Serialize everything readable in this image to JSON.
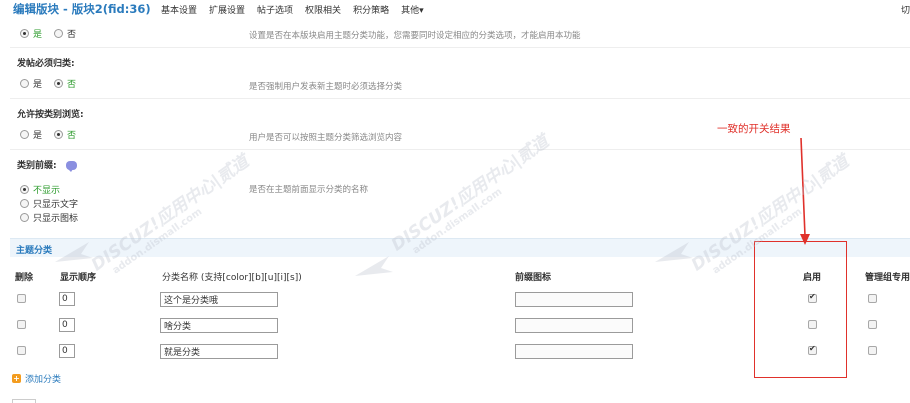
{
  "header": {
    "title": "编辑版块 - 版块2(fid:36)",
    "tabs": [
      "基本设置",
      "扩展设置",
      "帖子选项",
      "权限相关",
      "积分策略",
      "其他▾"
    ],
    "right_label": "切"
  },
  "settings": {
    "enable_topic": {
      "opt_yes": "是",
      "opt_no": "否",
      "selected": "yes",
      "desc": "设置是否在本版块启用主题分类功能，您需要同时设定相应的分类选项，才能启用本功能"
    },
    "require_category": {
      "label": "发帖必须归类:",
      "opt_yes": "是",
      "opt_no": "否",
      "selected": "no",
      "desc": "是否强制用户发表新主题时必须选择分类"
    },
    "browse_by_category": {
      "label": "允许按类别浏览:",
      "opt_yes": "是",
      "opt_no": "否",
      "selected": "no",
      "desc": "用户是否可以按照主题分类筛选浏览内容"
    },
    "category_prefix": {
      "label": "类别前缀:",
      "options": [
        "不显示",
        "只显示文字",
        "只显示图标"
      ],
      "selected": 0,
      "desc": "是否在主题前面显示分类的名称"
    }
  },
  "categories": {
    "section_title": "主题分类",
    "columns": {
      "delete": "删除",
      "order": "显示顺序",
      "name": "分类名称 (支持[color][b][u][i][s])",
      "icon": "前缀图标",
      "enable": "启用",
      "moderator": "管理组专用"
    },
    "rows": [
      {
        "order": "0",
        "name": "这个是分类哦",
        "enabled": true,
        "moderator_only": false
      },
      {
        "order": "0",
        "name": "啥分类",
        "enabled": false,
        "moderator_only": false
      },
      {
        "order": "0",
        "name": "就是分类",
        "enabled": true,
        "moderator_only": false
      }
    ],
    "add_label": "添加分类"
  },
  "annotation": {
    "text": "一致的开关结果",
    "color": "#e0312b"
  },
  "watermark": {
    "brand": "DISCUZ!应用中心|贰道",
    "site": "addon.dismall.com"
  },
  "colors": {
    "accent": "#2b7bbd",
    "selected_option": "#2a9a2a",
    "section_bg": "#eef5fb"
  }
}
